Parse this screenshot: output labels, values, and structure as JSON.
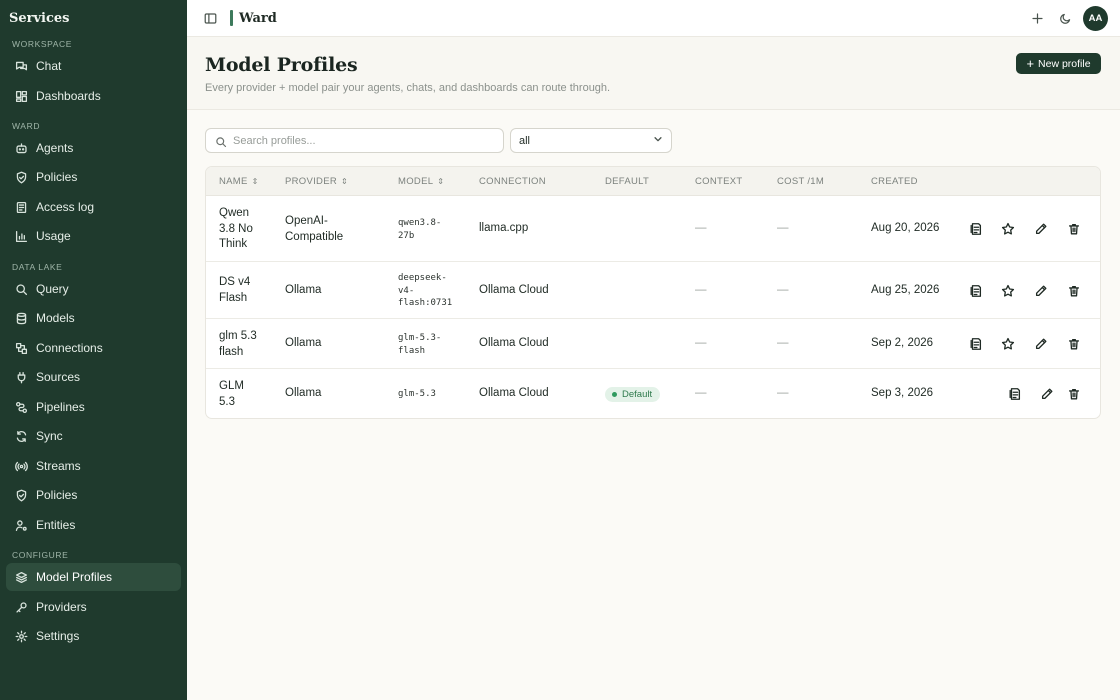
{
  "sidebar": {
    "brand": "Services",
    "sections": {
      "workspace": "Workspace",
      "ward": "Ward",
      "data_lake": "Data Lake",
      "configure": "Configure"
    },
    "items": {
      "chat": "Chat",
      "dashboards": "Dashboards",
      "agents": "Agents",
      "policies": "Policies",
      "access_log": "Access log",
      "usage": "Usage",
      "query": "Query",
      "models": "Models",
      "connections": "Connections",
      "sources": "Sources",
      "pipelines": "Pipelines",
      "sync": "Sync",
      "streams": "Streams",
      "policies_lake": "Policies",
      "entities": "Entities",
      "model_profiles": "Model Profiles",
      "providers": "Providers",
      "settings": "Settings"
    },
    "active": "model_profiles"
  },
  "topbar": {
    "workspace": "Ward",
    "avatar": "AA",
    "accent": "#3d7a5c"
  },
  "header": {
    "title": "Model Profiles",
    "subtitle": "Every provider + model pair your agents, chats, and dashboards can route through.",
    "new_button": "New profile"
  },
  "filters": {
    "search_placeholder": "Search profiles...",
    "select_value": "all"
  },
  "table": {
    "columns": {
      "name": "Name",
      "provider": "Provider",
      "model": "Model",
      "connection": "Connection",
      "default": "Default",
      "context": "Context",
      "cost": "Cost /1M",
      "created": "Created"
    },
    "rows": [
      {
        "name": "Qwen\n3.8 No\nThink",
        "provider": "OpenAI-\nCompatible",
        "model": "qwen3.8-\n27b",
        "connection": "llama.cpp",
        "default": "",
        "context": "—",
        "cost": "—",
        "created": "Aug 20, 2026",
        "is_default": false
      },
      {
        "name": "DS v4\nFlash",
        "provider": "Ollama",
        "model": "deepseek-\nv4-\nflash:0731",
        "connection": "Ollama Cloud",
        "default": "",
        "context": "—",
        "cost": "—",
        "created": "Aug 25, 2026",
        "is_default": false
      },
      {
        "name": "glm 5.3\nflash",
        "provider": "Ollama",
        "model": "glm-5.3-\nflash",
        "connection": "Ollama Cloud",
        "default": "",
        "context": "—",
        "cost": "—",
        "created": "Sep 2, 2026",
        "is_default": false
      },
      {
        "name": "GLM\n5.3",
        "provider": "Ollama",
        "model": "glm-5.3",
        "connection": "Ollama Cloud",
        "default": "Default",
        "context": "—",
        "cost": "—",
        "created": "Sep 3, 2026",
        "is_default": true
      }
    ]
  },
  "colors": {
    "sidebar_bg": "#1f3a2d",
    "badge_text": "#2e7a4c",
    "badge_bg": "#e3f2e8"
  }
}
